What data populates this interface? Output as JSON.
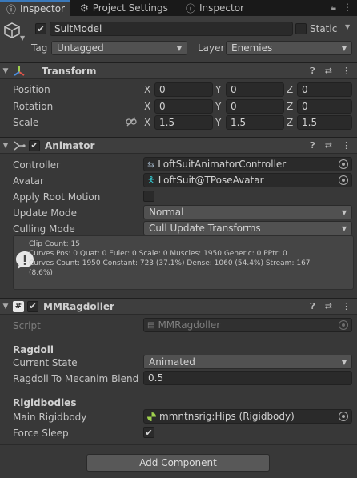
{
  "tabs": [
    {
      "label": "Inspector",
      "icon": "info-icon"
    },
    {
      "label": "Project Settings",
      "icon": "gear-icon"
    },
    {
      "label": "Inspector",
      "icon": "info-icon"
    }
  ],
  "object": {
    "name": "SuitModel",
    "static_label": "Static",
    "tag_label": "Tag",
    "tag_value": "Untagged",
    "layer_label": "Layer",
    "layer_value": "Enemies"
  },
  "transform": {
    "title": "Transform",
    "position_label": "Position",
    "rotation_label": "Rotation",
    "scale_label": "Scale",
    "axis_x": "X",
    "axis_y": "Y",
    "axis_z": "Z",
    "position": {
      "x": "0",
      "y": "0",
      "z": "0"
    },
    "rotation": {
      "x": "0",
      "y": "0",
      "z": "0"
    },
    "scale": {
      "x": "1.5",
      "y": "1.5",
      "z": "1.5"
    }
  },
  "animator": {
    "title": "Animator",
    "controller_label": "Controller",
    "controller_value": "LoftSuitAnimatorController",
    "avatar_label": "Avatar",
    "avatar_value": "LoftSuit@TPoseAvatar",
    "apply_root_motion_label": "Apply Root Motion",
    "update_mode_label": "Update Mode",
    "update_mode_value": "Normal",
    "culling_mode_label": "Culling Mode",
    "culling_mode_value": "Cull Update Transforms",
    "info_lines": [
      "Clip Count: 15",
      "Curves Pos: 0 Quat: 0 Euler: 0 Scale: 0 Muscles: 1950 Generic: 0 PPtr: 0",
      "Curves Count: 1950 Constant: 723 (37.1%) Dense: 1060 (54.4%) Stream: 167",
      "(8.6%)"
    ]
  },
  "ragdoller": {
    "title": "MMRagdoller",
    "script_label": "Script",
    "script_value": "MMRagdoller",
    "ragdoll_section": "Ragdoll",
    "current_state_label": "Current State",
    "current_state_value": "Animated",
    "blend_label": "Ragdoll To Mecanim Blend D",
    "blend_value": "0.5",
    "rigidbodies_section": "Rigidbodies",
    "main_rigidbody_label": "Main Rigidbody",
    "main_rigidbody_value": "mmntnsrig:Hips (Rigidbody)",
    "force_sleep_label": "Force Sleep"
  },
  "add_component_label": "Add Component",
  "colors": {
    "accent": "#3a79bb",
    "background": "#383838",
    "field": "#2a2a2a"
  }
}
